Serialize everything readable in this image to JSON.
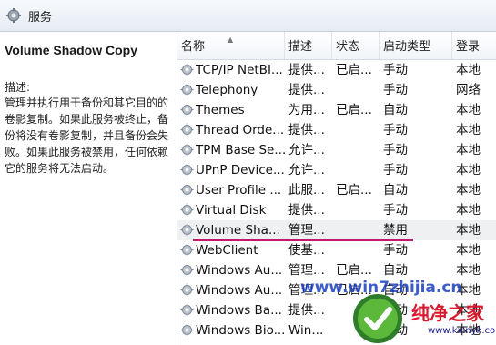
{
  "window": {
    "title": "服务"
  },
  "left_pane": {
    "service_name": "Volume Shadow Copy",
    "description_label": "描述:",
    "description": "管理并执行用于备份和其它目的的卷影复制。如果此服务被终止，备份将没有卷影复制，并且备份会失败。如果此服务被禁用，任何依赖它的服务将无法启动。"
  },
  "table": {
    "columns": [
      "名称",
      "描述",
      "状态",
      "启动类型",
      "登录"
    ],
    "rows": [
      {
        "name": "TCP/IP NetBI...",
        "desc": "提供...",
        "status": "已启...",
        "startup": "手动",
        "logon": "本地"
      },
      {
        "name": "Telephony",
        "desc": "提供...",
        "status": "",
        "startup": "手动",
        "logon": "网络"
      },
      {
        "name": "Themes",
        "desc": "为用...",
        "status": "已启...",
        "startup": "自动",
        "logon": "本地"
      },
      {
        "name": "Thread Orde...",
        "desc": "提供...",
        "status": "",
        "startup": "手动",
        "logon": "本地"
      },
      {
        "name": "TPM Base Se...",
        "desc": "允许...",
        "status": "",
        "startup": "手动",
        "logon": "本地"
      },
      {
        "name": "UPnP Device...",
        "desc": "允许...",
        "status": "",
        "startup": "手动",
        "logon": "本地"
      },
      {
        "name": "User Profile ...",
        "desc": "此服...",
        "status": "已启...",
        "startup": "自动",
        "logon": "本地"
      },
      {
        "name": "Virtual Disk",
        "desc": "提供...",
        "status": "",
        "startup": "手动",
        "logon": "本地"
      },
      {
        "name": "Volume Sha...",
        "desc": "管理...",
        "status": "",
        "startup": "禁用",
        "logon": "本地"
      },
      {
        "name": "WebClient",
        "desc": "使基...",
        "status": "",
        "startup": "手动",
        "logon": "本地"
      },
      {
        "name": "Windows Au...",
        "desc": "管理...",
        "status": "已启...",
        "startup": "自动",
        "logon": "本地"
      },
      {
        "name": "Windows Au...",
        "desc": "管理...",
        "status": "已启...",
        "startup": "自动",
        "logon": "本地"
      },
      {
        "name": "Windows Ba...",
        "desc": "提供...",
        "status": "",
        "startup": "手动",
        "logon": "本地"
      },
      {
        "name": "Windows Bio...",
        "desc": "Win...",
        "status": "",
        "startup": "手动",
        "logon": "本地"
      }
    ]
  },
  "watermark": {
    "url": "www.win7zhijia.cn",
    "brand": "纯净之家",
    "site": "www.kxinyk.com"
  },
  "colors": {
    "highlight_underline": "#c2186e",
    "watermark_blue": "#1a3fbf"
  }
}
